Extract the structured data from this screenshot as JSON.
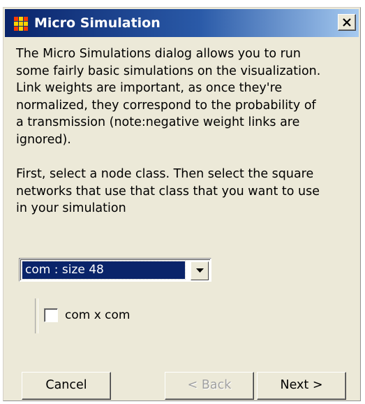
{
  "window": {
    "title": "Micro Simulation",
    "close_label": "✕"
  },
  "description": {
    "paragraph1": "The Micro Simulations dialog allows you to run\nsome fairly basic simulations on the visualization.\nLink weights are important, as once they're\nnormalized, they correspond to the probability of\na transmission (note:negative weight links are\nignored).",
    "paragraph2": "First, select a node class. Then select the square\nnetworks that use that class that you want to use\nin your simulation"
  },
  "node_class_select": {
    "selected": "com : size 48"
  },
  "networks": [
    {
      "label": "com x com",
      "checked": false
    }
  ],
  "buttons": {
    "cancel": "Cancel",
    "back": "< Back",
    "next": "Next >"
  },
  "colors": {
    "titlebar_start": "#0a246a",
    "titlebar_end": "#a6caf0",
    "dialog_bg": "#ece9d8",
    "selection_bg": "#0a246a"
  }
}
